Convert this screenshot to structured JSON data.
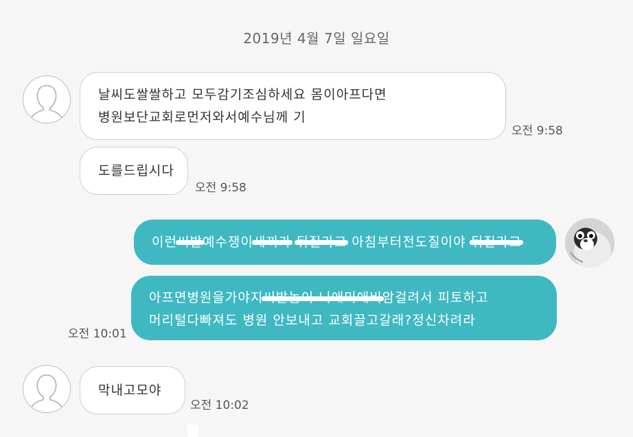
{
  "date_header": "2019년 4월 7일 일요일",
  "messages": [
    {
      "direction": "incoming",
      "lines": [
        "날씨도쌀쌀하고 모두감기조심하세요 몸이아프다면",
        "병원보단교회로먼저와서예수님께  기"
      ],
      "time": "오전 9:58"
    },
    {
      "direction": "incoming",
      "lines": [
        "도를드립시다"
      ],
      "time": "오전 9:58"
    },
    {
      "direction": "outgoing",
      "line1": {
        "a": "이런",
        "b": "씨발",
        "c": "예수쟁이",
        "d": "새끼가",
        "e": " ",
        "f": "뒤질라고",
        "g": " 아침부터전도질이야 ",
        "h": "뒤질라고"
      }
    },
    {
      "direction": "outgoing",
      "line1": {
        "a": "아프면병원을가야지",
        "b": "씨발놈이 니애미애비",
        "c": "암걸려서 피토하고"
      },
      "line2": "머리털다빠져도 병원 안보내고 교회끌고갈래?정신차려라",
      "time": "오전 10:01"
    },
    {
      "direction": "incoming",
      "lines": [
        "막내고모야"
      ],
      "time": "오전 10:02"
    }
  ],
  "colors": {
    "background": "#f6f6f6",
    "incoming_bubble": "#ffffff",
    "outgoing_bubble": "#3fb8c2",
    "outgoing_text": "#ffffff"
  },
  "icons": {
    "sender_avatar": "default-person-avatar-icon",
    "my_avatar": "penguin-avatar"
  }
}
